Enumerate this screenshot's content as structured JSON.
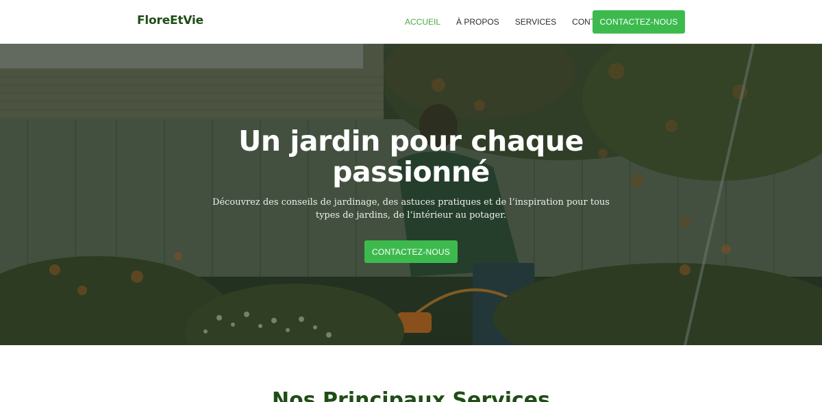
{
  "brand": {
    "name": "FloreEtVie"
  },
  "nav": {
    "items": [
      {
        "label": "ACCUEIL",
        "active": true
      },
      {
        "label": "À PROPOS",
        "active": false
      },
      {
        "label": "SERVICES",
        "active": false
      },
      {
        "label": "CONTACT",
        "active": false
      }
    ],
    "cta_label": "CONTACTEZ-NOUS"
  },
  "hero": {
    "title": "Un jardin pour chaque passionné",
    "subtitle": "Découvrez des conseils de jardinage, des astuces pratiques et de l’inspiration pour tous types de jardins, de l’intérieur au potager.",
    "cta_label": "CONTACTEZ-NOUS"
  },
  "services": {
    "title": "Nos Principaux Services"
  },
  "colors": {
    "accent": "#3dba4e",
    "brand_dark_green": "#1f4d16",
    "active_link": "#4aaa3f",
    "text_dark": "#2a2a2a"
  }
}
